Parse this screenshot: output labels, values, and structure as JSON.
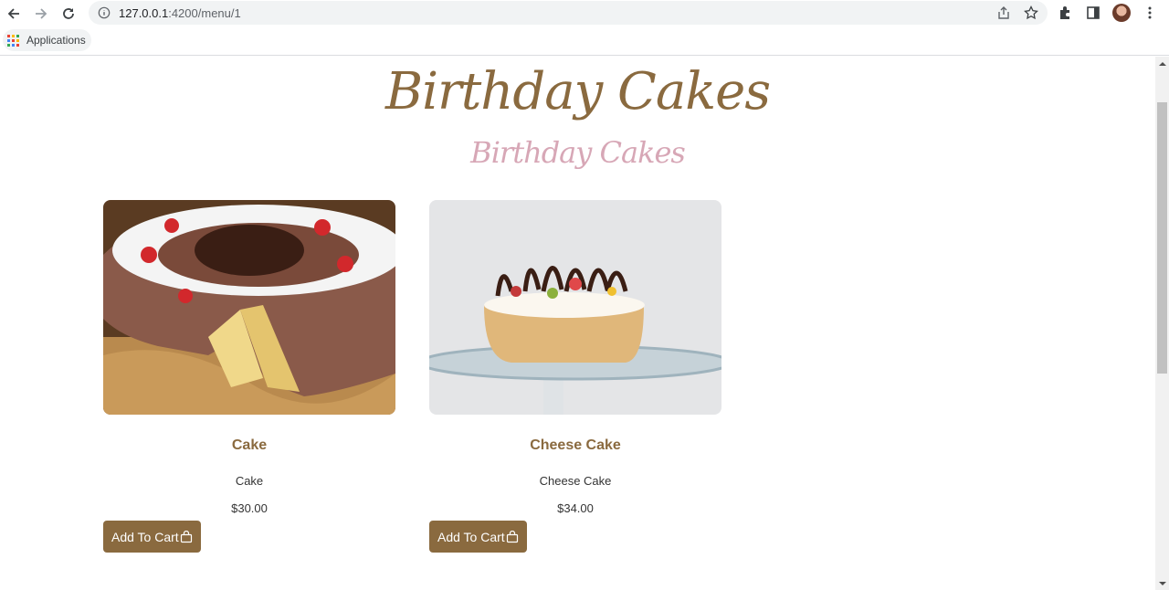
{
  "browser": {
    "url_host": "127.0.0.1",
    "url_path": ":4200/menu/1",
    "bookmark_label": "Applications"
  },
  "page": {
    "title": "Birthday Cakes",
    "subtitle": "Birthday Cakes"
  },
  "products": [
    {
      "name": "Cake",
      "description": "Cake",
      "price": "$30.00",
      "button_label": "Add To Cart"
    },
    {
      "name": "Cheese Cake",
      "description": "Cheese Cake",
      "price": "$34.00",
      "button_label": "Add To Cart"
    }
  ],
  "colors": {
    "brand": "#8a6a3f",
    "subtitle": "#d7a7b6"
  },
  "icons": [
    "back-icon",
    "forward-icon",
    "reload-icon",
    "info-icon",
    "share-icon",
    "star-icon",
    "extensions-icon",
    "sidepanel-icon",
    "menu-icon",
    "apps-icon",
    "shopping-bag-icon"
  ]
}
